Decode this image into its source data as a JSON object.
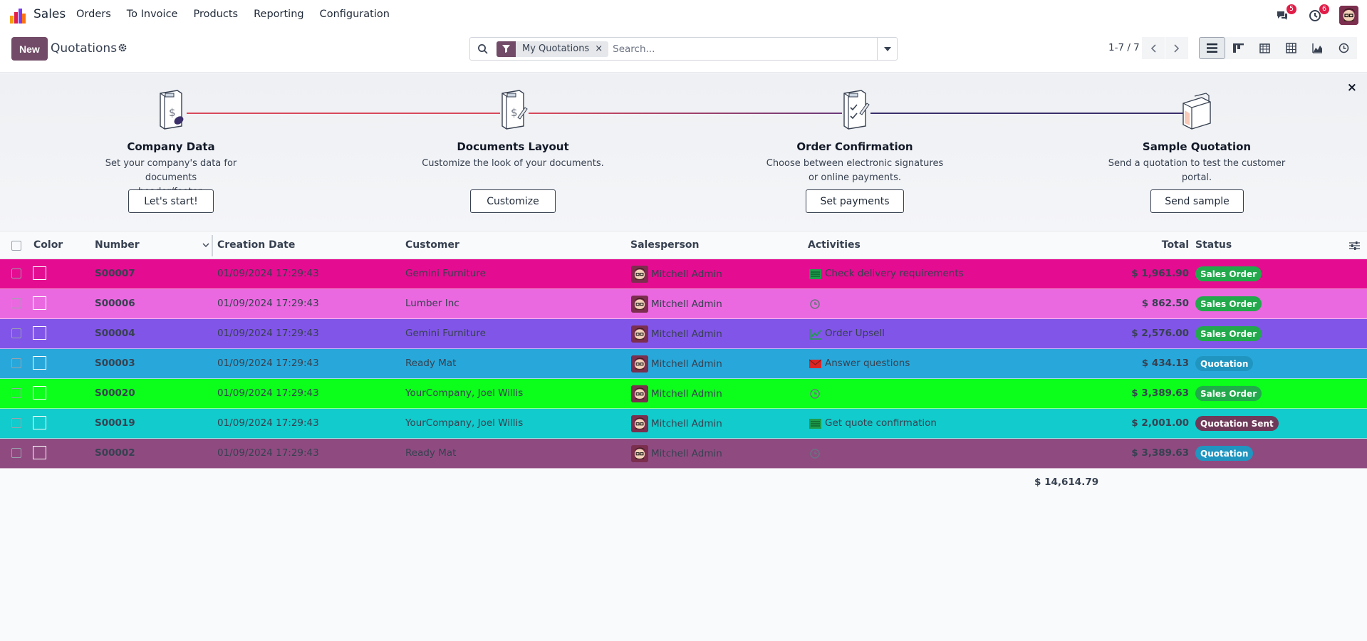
{
  "navbar": {
    "app_name": "Sales",
    "menu": [
      "Orders",
      "To Invoice",
      "Products",
      "Reporting",
      "Configuration"
    ],
    "messages_count": "5",
    "activities_count": "6"
  },
  "control": {
    "new_label": "New",
    "title": "Quotations",
    "facet_label": "My Quotations",
    "facet_remove": "×",
    "search_placeholder": "Search...",
    "pager": "1-7 / 7"
  },
  "onboarding": {
    "close": "×",
    "steps": [
      {
        "title": "Company Data",
        "desc_line1": "Set your company's data for documents",
        "desc_line2": "header/footer.",
        "button": "Let's start!"
      },
      {
        "title": "Documents Layout",
        "desc_line1": "Customize the look of your documents.",
        "desc_line2": "",
        "button": "Customize"
      },
      {
        "title": "Order Confirmation",
        "desc_line1": "Choose between electronic signatures",
        "desc_line2": "or online payments.",
        "button": "Set payments"
      },
      {
        "title": "Sample Quotation",
        "desc_line1": "Send a quotation to test the customer",
        "desc_line2": "portal.",
        "button": "Send sample"
      }
    ]
  },
  "table": {
    "headers": {
      "color": "Color",
      "number": "Number",
      "creation_date": "Creation Date",
      "customer": "Customer",
      "salesperson": "Salesperson",
      "activities": "Activities",
      "total": "Total",
      "status": "Status"
    },
    "rows": [
      {
        "number": "S00007",
        "date": "01/09/2024 17:29:43",
        "customer": "Gemini Furniture",
        "salesperson": "Mitchell Admin",
        "activity": "Check delivery requirements",
        "activity_icon": "list-icon",
        "total": "$ 1,961.90",
        "status": "Sales Order",
        "bg": "#e40c91",
        "status_color": "#22a94b"
      },
      {
        "number": "S00006",
        "date": "01/09/2024 17:29:43",
        "customer": "Lumber Inc",
        "salesperson": "Mitchell Admin",
        "activity": "",
        "activity_icon": "clock-icon",
        "total": "$ 862.50",
        "status": "Sales Order",
        "bg": "#ea69e0",
        "status_color": "#22a94b"
      },
      {
        "number": "S00004",
        "date": "01/09/2024 17:29:43",
        "customer": "Gemini Furniture",
        "salesperson": "Mitchell Admin",
        "activity": "Order Upsell",
        "activity_icon": "chart-icon",
        "total": "$ 2,576.00",
        "status": "Sales Order",
        "bg": "#8155e8",
        "status_color": "#22a94b"
      },
      {
        "number": "S00003",
        "date": "01/09/2024 17:29:43",
        "customer": "Ready Mat",
        "salesperson": "Mitchell Admin",
        "activity": "Answer questions",
        "activity_icon": "envelope-icon",
        "total": "$ 434.13",
        "status": "Quotation",
        "bg": "#28a8da",
        "status_color": "#1f95c0"
      },
      {
        "number": "S00020",
        "date": "01/09/2024 17:29:43",
        "customer": "YourCompany, Joel Willis",
        "salesperson": "Mitchell Admin",
        "activity": "",
        "activity_icon": "clock-icon",
        "total": "$ 3,389.63",
        "status": "Sales Order",
        "bg": "#0cfe1b",
        "status_color": "#22a94b"
      },
      {
        "number": "S00019",
        "date": "01/09/2024 17:29:43",
        "customer": "YourCompany, Joel Willis",
        "salesperson": "Mitchell Admin",
        "activity": "Get quote confirmation",
        "activity_icon": "list-icon",
        "total": "$ 2,001.00",
        "status": "Quotation Sent",
        "bg": "#11cbcc",
        "status_color": "#6f3a59"
      },
      {
        "number": "S00002",
        "date": "01/09/2024 17:29:43",
        "customer": "Ready Mat",
        "salesperson": "Mitchell Admin",
        "activity": "",
        "activity_icon": "clock-icon",
        "total": "$ 3,389.63",
        "status": "Quotation",
        "bg": "#8f4b80",
        "status_color": "#1f95c0"
      }
    ],
    "grand_total": "$ 14,614.79"
  }
}
